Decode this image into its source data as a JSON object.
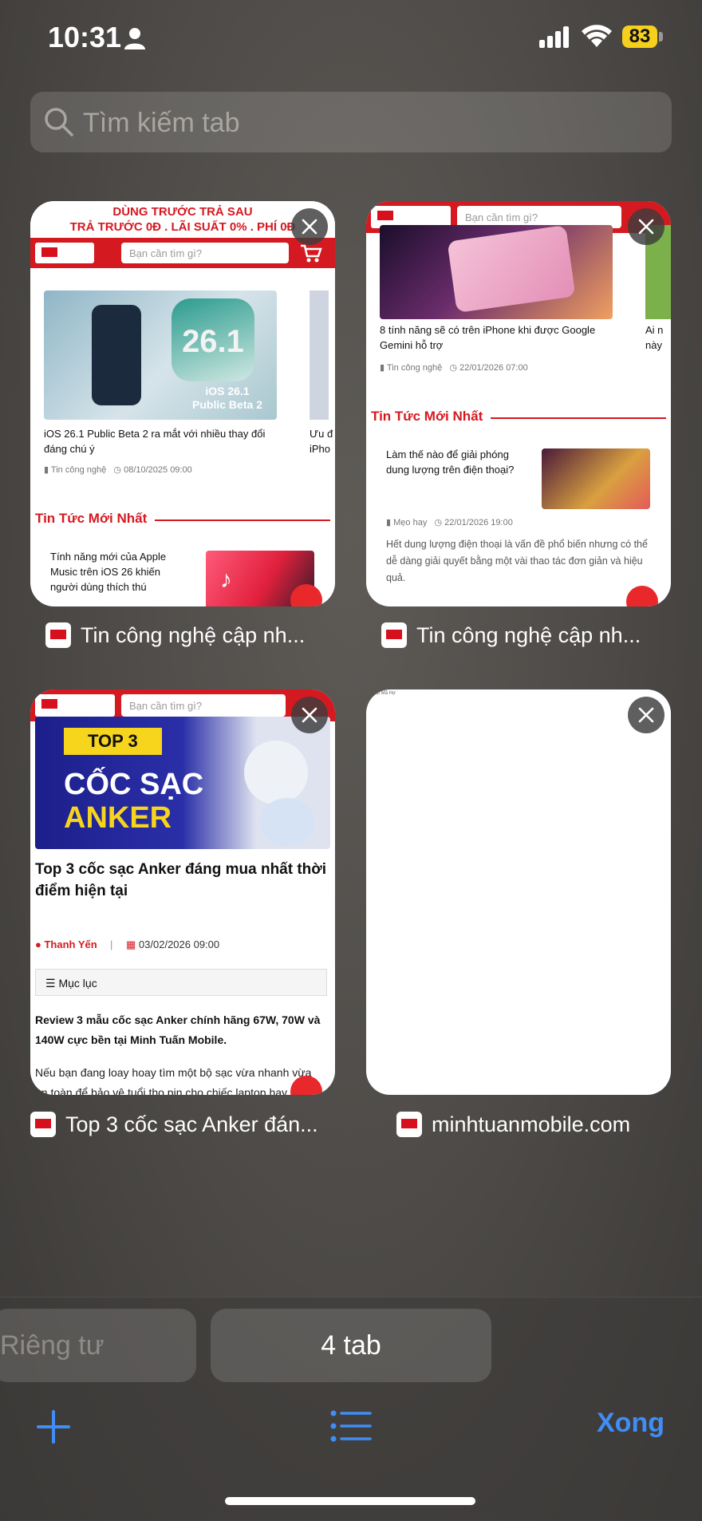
{
  "status_bar": {
    "time": "10:31",
    "battery": "83"
  },
  "search": {
    "placeholder": "Tìm kiếm tab"
  },
  "tabs": [
    {
      "title": "Tin công nghệ cập nh...",
      "promo_line1": "DÙNG TRƯỚC TRẢ SAU",
      "promo_line2": "TRẢ TRƯỚC 0Đ . LÃI SUẤT 0% . PHÍ 0Đ",
      "search_placeholder": "Bạn cần tìm gì?",
      "article_title": "iOS 26.1 Public Beta 2 ra mắt với nhiều thay đổi đáng chú ý",
      "article_category": "Tin công nghệ",
      "article_time": "08/10/2025 09:00",
      "thumb_line1": "iOS 26.1",
      "thumb_line2": "Public Beta 2",
      "thumb_badge": "26.1",
      "side_title": "Ưu đ iPho",
      "section": "Tin Tức Mới Nhất",
      "list_title": "Tính năng mới của Apple Music trên iOS 26 khiến người dùng thích thú"
    },
    {
      "title": "Tin công nghệ cập nh...",
      "search_placeholder": "Bạn cần tìm gì?",
      "article_title": "8 tính năng sẽ có trên iPhone khi được Google Gemini hỗ trợ",
      "article_category": "Tin công nghệ",
      "article_time": "22/01/2026 07:00",
      "side_title": "Ai n này",
      "section": "Tin Tức Mới Nhất",
      "list_title": "Làm thế nào để giải phóng dung lượng trên điện thoại?",
      "list_category": "Mẹo hay",
      "list_time": "22/01/2026 19:00",
      "list_excerpt": "Hết dung lượng điện thoại là vấn đề phổ biến nhưng có thể dễ dàng giải quyết bằng một vài thao tác đơn giản và hiệu quả."
    },
    {
      "title": "Top 3 cốc sạc Anker đán...",
      "search_placeholder": "Bạn cần tìm gì?",
      "banner_tag": "TOP 3",
      "banner_line1": "CỐC SẠC",
      "banner_line2": "ANKER",
      "article_title": "Top 3 cốc sạc Anker đáng mua nhất thời điểm hiện tại",
      "author": "Thanh Yến",
      "date": "03/02/2026 09:00",
      "toc": "Mục lục",
      "lead": "Review 3 mẫu cốc sạc Anker chính hãng 67W, 70W và 140W cực bền tại Minh Tuấn Mobile.",
      "body": "Nếu bạn đang loay hoay tìm một bộ sạc vừa nhanh vừa an toàn để bảo vệ tuổi thọ pin cho chiếc laptop hay điện"
    },
    {
      "title": "minhtuanmobile.com",
      "tiny_text": "Hội Mã Hợ"
    }
  ],
  "bottom": {
    "private_label": "Riêng tư",
    "tabs_label": "4 tab",
    "done_label": "Xong"
  },
  "colors": {
    "accent": "#3f8ef7",
    "brand_red": "#d51920",
    "battery": "#f6d01c"
  }
}
